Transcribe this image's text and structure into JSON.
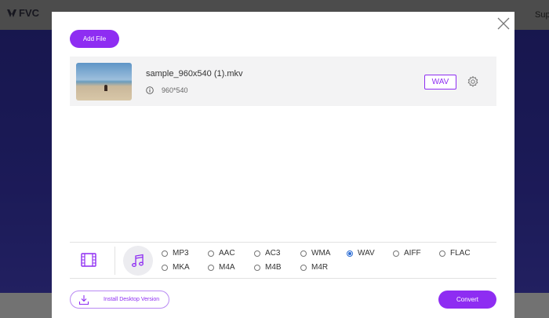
{
  "background": {
    "logo_text": "FVC",
    "nav_partial": "Sup"
  },
  "modal": {
    "add_file_label": "Add File",
    "file": {
      "name": "sample_960x540 (1).mkv",
      "resolution": "960*540",
      "output_format": "WAV"
    },
    "formats_row1": [
      "MP3",
      "AAC",
      "AC3",
      "WMA",
      "WAV",
      "AIFF",
      "FLAC"
    ],
    "formats_row2": [
      "MKA",
      "M4A",
      "M4B",
      "M4R"
    ],
    "selected_format": "WAV",
    "install_label": "Install Desktop Version",
    "convert_label": "Convert"
  },
  "colors": {
    "accent": "#8e2df2",
    "header_bg": "#8a8a8a",
    "hero_bg": "#2b2a8f"
  },
  "icons": [
    "close-icon",
    "info-icon",
    "settings-icon",
    "video-icon",
    "music-icon",
    "download-icon"
  ]
}
